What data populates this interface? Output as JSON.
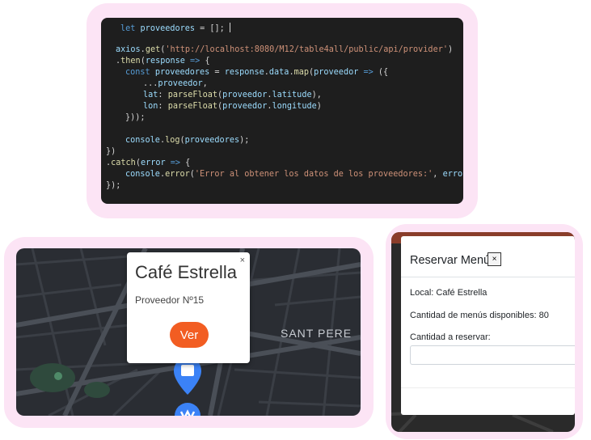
{
  "code": {
    "lines": [
      "let proveedores = [];",
      "axios.get('http://localhost:8080/M12/table4all/public/api/provider')",
      ".then(response => {",
      "const proveedores = response.data.map(proveedor => ({",
      "...proveedor,",
      "lat: parseFloat(proveedor.latitude),",
      "lon: parseFloat(proveedor.longitude)",
      "}));",
      "console.log(proveedores);",
      "})",
      ".catch(error => {",
      "console.error('Error al obtener los datos de los proveedores:', error);",
      "});"
    ]
  },
  "map": {
    "district_label": "SANT PERE",
    "popup": {
      "title": "Café Estrella",
      "close": "×",
      "subtitle": "Proveedor Nº15",
      "button": "Ver"
    },
    "colors": {
      "background": "#2a2d33",
      "roads": "#4a4f57",
      "marker": "#3b82f6",
      "park": "#2f4a3d"
    }
  },
  "modal": {
    "title": "Reservar Menú",
    "close": "×",
    "local": "Local: Café Estrella",
    "available": "Cantidad de menús disponibles: 80",
    "reserve_label": "Cantidad a reservar:",
    "reserve_value": ""
  }
}
